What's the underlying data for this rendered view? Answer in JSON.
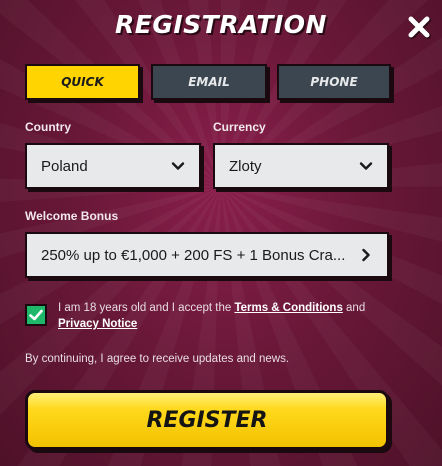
{
  "header": {
    "title": "REGISTRATION",
    "close_icon": "close-icon"
  },
  "tabs": [
    {
      "label": "QUICK",
      "active": true
    },
    {
      "label": "EMAIL",
      "active": false
    },
    {
      "label": "PHONE",
      "active": false
    }
  ],
  "country": {
    "label": "Country",
    "value": "Poland"
  },
  "currency": {
    "label": "Currency",
    "value": "Zloty"
  },
  "bonus": {
    "label": "Welcome Bonus",
    "value": "250% up to €1,000 + 200 FS + 1 Bonus Cra..."
  },
  "consent": {
    "checked": true,
    "text_prefix": "I am 18 years old and I accept the ",
    "terms_link": "Terms & Conditions",
    "text_mid": " and",
    "privacy_link": "Privacy Notice"
  },
  "notice": "By continuing, I agree to receive updates and news.",
  "register_label": "REGISTER",
  "colors": {
    "background": "#6a1838",
    "active_tab": "#ffd400",
    "inactive_tab": "#3c4650",
    "checkbox": "#1fb86a",
    "register": "#ffd91c"
  }
}
